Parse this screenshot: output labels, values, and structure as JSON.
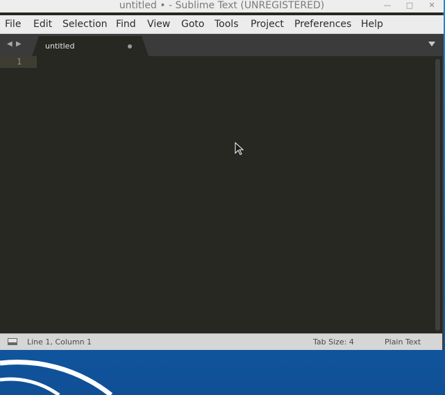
{
  "window": {
    "title": "untitled • - Sublime Text (UNREGISTERED)",
    "controls": {
      "minimize_icon": "minimize-icon",
      "maximize_icon": "maximize-icon",
      "close_icon": "close-icon"
    }
  },
  "menubar": {
    "items": [
      "File",
      "Edit",
      "Selection",
      "Find",
      "View",
      "Goto",
      "Tools",
      "Project",
      "Preferences",
      "Help"
    ]
  },
  "tabs": {
    "nav_back_icon": "chevron-left-icon",
    "nav_forward_icon": "chevron-right-icon",
    "items": [
      {
        "label": "untitled",
        "dirty": true,
        "active": true
      }
    ],
    "dropdown_icon": "triangle-down-icon"
  },
  "editor": {
    "line_numbers": [
      "1"
    ],
    "content": ""
  },
  "statusbar": {
    "position": "Line 1, Column 1",
    "tab_size": "Tab Size: 4",
    "syntax": "Plain Text"
  },
  "colors": {
    "editor_bg": "#272822",
    "tabbar_bg": "#3b3b3b",
    "active_tab_bg": "#272822",
    "statusbar_bg": "#d6d6d6",
    "menubar_bg": "#ececec",
    "desktop_accent": "#1d8ad8"
  }
}
